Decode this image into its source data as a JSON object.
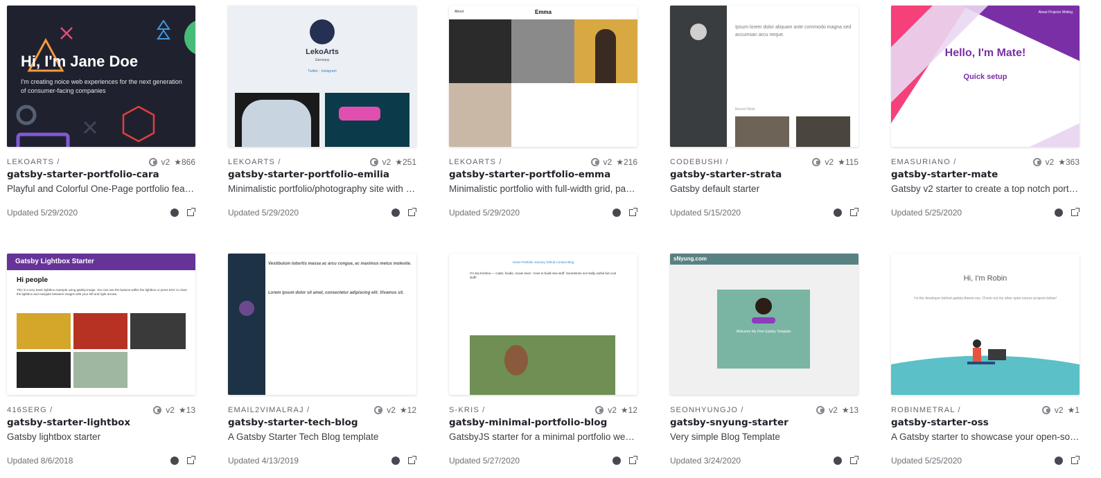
{
  "cards": [
    {
      "owner": "LEKOARTS /",
      "version": "v2",
      "stars": "★866",
      "name": "gatsby-starter-portfolio-cara",
      "description": "Playful and Colorful One-Page portfolio featuring parallax effects and animations",
      "updated": "Updated 5/29/2020",
      "thumb": {
        "heading": "Hi, I'm Jane Doe",
        "text": "I'm creating noice web experiences for the next generation of consumer-facing companies"
      }
    },
    {
      "owner": "LEKOARTS /",
      "version": "v2",
      "stars": "★251",
      "name": "gatsby-starter-portfolio-emilia",
      "description": "Minimalistic portfolio/photography site with masonry grid",
      "updated": "Updated 5/29/2020",
      "thumb": {
        "title": "LekoArts",
        "subtitle": "Germany",
        "links": "Twitter · Instagram"
      }
    },
    {
      "owner": "LEKOARTS /",
      "version": "v2",
      "stars": "★216",
      "name": "gatsby-starter-portfolio-emma",
      "description": "Minimalistic portfolio with full-width grid, page transitions",
      "updated": "Updated 5/29/2020",
      "thumb": {
        "nav": "About",
        "brand": "Emma"
      }
    },
    {
      "owner": "CODEBUSHI /",
      "version": "v2",
      "stars": "★115",
      "name": "gatsby-starter-strata",
      "description": "Gatsby default starter",
      "updated": "Updated 5/15/2020",
      "thumb": {
        "intro": "Ipsum lorem dolor aliquam ante commodo magna sed accumsan arcu neque.",
        "recent": "Recent Work"
      }
    },
    {
      "owner": "EMASURIANO /",
      "version": "v2",
      "stars": "★363",
      "name": "gatsby-starter-mate",
      "description": "Gatsby v2 starter to create a top notch portfolio",
      "updated": "Updated 5/25/2020",
      "thumb": {
        "hello": "Hello, I'm Mate!",
        "quick": "Quick setup",
        "nav": "About  Projects  Writing"
      }
    },
    {
      "owner": "416SERG /",
      "version": "v2",
      "stars": "★13",
      "name": "gatsby-starter-lightbox",
      "description": "Gatsby lightbox starter",
      "updated": "Updated 8/6/2018",
      "thumb": {
        "bar": "Gatsby Lightbox Starter",
        "heading": "Hi people",
        "text": "This is a very basic lightbox example using gatsby-image. You can use the buttons within the lightbox or press ESC to close the lightbox and navigate between images with your left and right arrows."
      }
    },
    {
      "owner": "EMAIL2VIMALRAJ /",
      "version": "v2",
      "stars": "★12",
      "name": "gatsby-starter-tech-blog",
      "description": "A Gatsby Starter Tech Blog template",
      "updated": "Updated 4/13/2019",
      "thumb": {
        "post1": "Vestibulum lobortis massa ac arcu congue, ac maximus metus molestie.",
        "post2": "Lorem ipsum dolor sit amet, consectetur adipiscing elit. Vivamus sit."
      }
    },
    {
      "owner": "S-KRIS /",
      "version": "v2",
      "stars": "★12",
      "name": "gatsby-minimal-portfolio-blog",
      "description": "GatsbyJS starter for a minimal portfolio website",
      "updated": "Updated 5/27/2020",
      "thumb": {
        "nav": "Home   Portfolio   Journey   Github   Contact   Blog",
        "text": "I'm Sai Krishna — coder, foodie, movie lover. I love to build new stuff. Sometimes not really useful but cool stuff!"
      }
    },
    {
      "owner": "SEONHYUNGJO /",
      "version": "v2",
      "stars": "★13",
      "name": "gatsby-snyung-starter",
      "description": "Very simple Blog Template",
      "updated": "Updated 3/24/2020",
      "thumb": {
        "bar": "sNyung.com",
        "welcome": "Welcome My First Gatsby Template"
      }
    },
    {
      "owner": "ROBINMETRAL /",
      "version": "v2",
      "stars": "★1",
      "name": "gatsby-starter-oss",
      "description": "A Gatsby starter to showcase your open-source projects",
      "updated": "Updated 5/25/2020",
      "thumb": {
        "hi": "Hi, I'm Robin",
        "sub": "I'm the developer behind gatsby-theme-oss. Check out my other open-source projects below!"
      }
    }
  ]
}
